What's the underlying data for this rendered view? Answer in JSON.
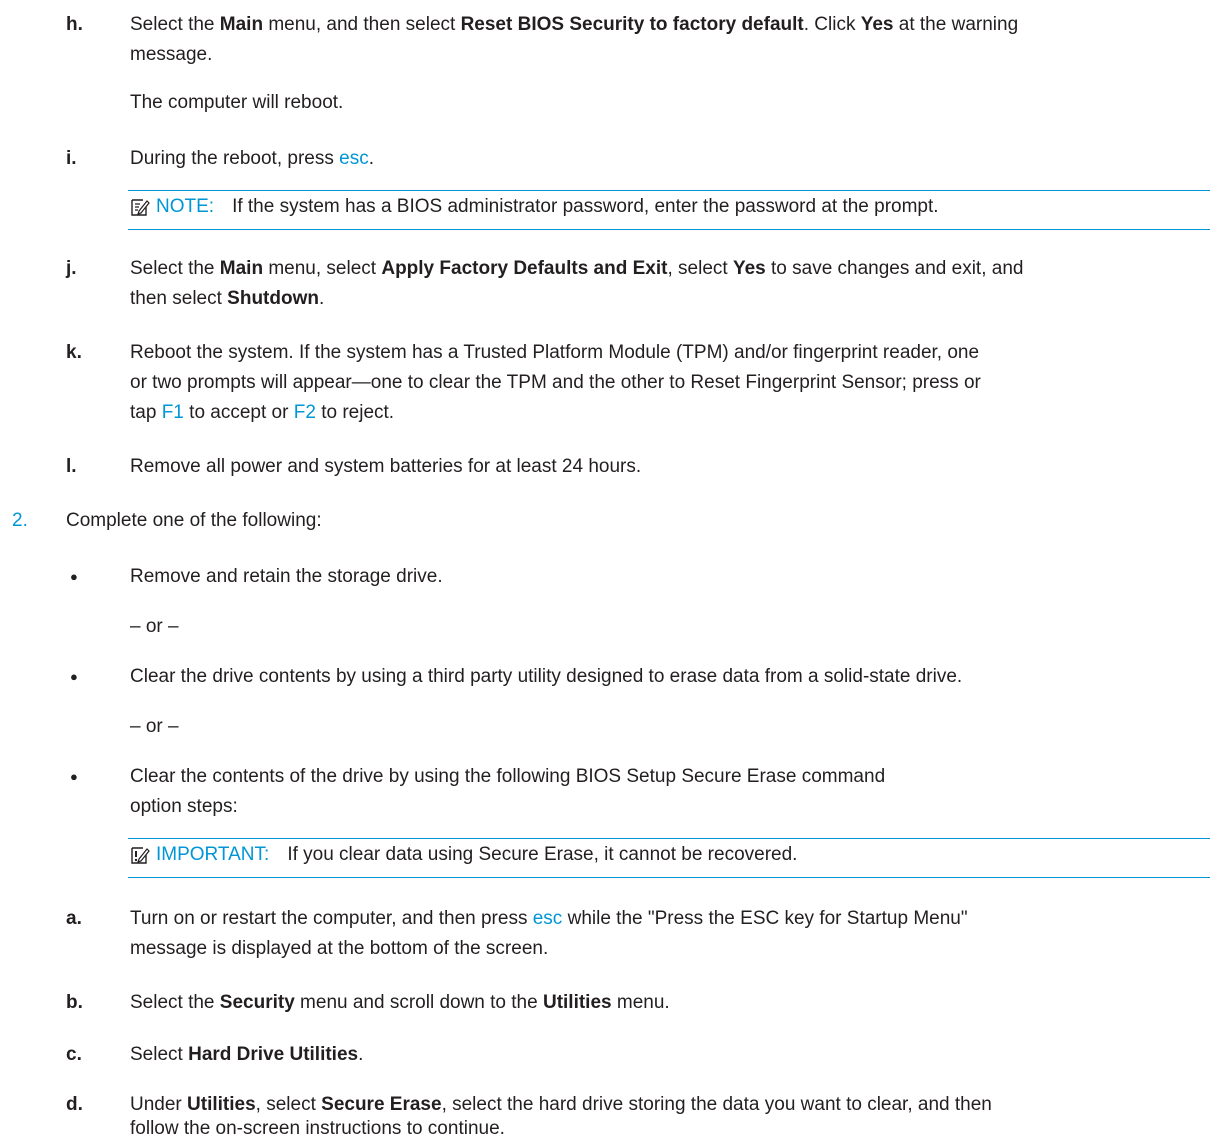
{
  "steps": {
    "h": {
      "marker": "h.",
      "p1": "Select the ",
      "main": "Main",
      "p2": " menu, and then select ",
      "reset": "Reset BIOS Security to factory default",
      "p3": ". Click ",
      "yes": "Yes",
      "p4": " at the warning",
      "line2": "message.",
      "reboot": "The computer will reboot."
    },
    "i": {
      "marker": "i.",
      "p1": "During the reboot, press ",
      "key": "esc",
      "p2": "."
    },
    "note": {
      "label": "NOTE:",
      "text": "If the system has a BIOS administrator password, enter the password at the prompt."
    },
    "j": {
      "marker": "j.",
      "p1": "Select the ",
      "main": "Main",
      "p2": " menu, select ",
      "apply": "Apply Factory Defaults and Exit",
      "p3": ", select ",
      "yes": "Yes",
      "p4": " to save changes and exit, and",
      "p5": "then select ",
      "shutdown": "Shutdown",
      "p6": "."
    },
    "k": {
      "marker": "k.",
      "line1": "Reboot the system. If the system has a Trusted Platform Module (TPM) and/or fingerprint reader, one",
      "line2": "or two prompts will appear—one to clear the TPM and the other to Reset Fingerprint Sensor; press or",
      "p1": "tap ",
      "f1": "F1",
      "p2": " to accept or ",
      "f2": "F2",
      "p3": " to reject."
    },
    "l": {
      "marker": "l.",
      "text": "Remove all power and system batteries for at least 24 hours."
    }
  },
  "step2": {
    "number": "2.",
    "text": "Complete one of the following:",
    "bullets": [
      "Remove and retain the storage drive.",
      "Clear the drive contents by using a third party utility designed to erase data from a solid-state drive.",
      "Clear the contents of the drive by using the following BIOS Setup Secure Erase command"
    ],
    "bullet3_line2": "option steps:",
    "or": "– or –",
    "bullet_char": "●"
  },
  "important": {
    "label": "IMPORTANT:",
    "text": "If you clear data using Secure Erase, it cannot be recovered."
  },
  "substeps": {
    "a": {
      "marker": "a.",
      "p1": "Turn on or restart the computer, and then press ",
      "key": "esc",
      "p2": " while the \"Press the ESC key for Startup Menu\"",
      "line2": "message is displayed at the bottom of the screen."
    },
    "b": {
      "marker": "b.",
      "p1": "Select the ",
      "security": "Security",
      "p2": " menu and scroll down to the ",
      "utilities": "Utilities",
      "p3": " menu."
    },
    "c": {
      "marker": "c.",
      "p1": "Select ",
      "hdu": "Hard Drive Utilities",
      "p2": "."
    },
    "d": {
      "marker": "d.",
      "p1": "Under ",
      "utilities": "Utilities",
      "p2": ", select ",
      "secure": "Secure Erase",
      "p3": ", select the hard drive storing the data you want to clear, and then",
      "line2": "follow the on-screen instructions to continue."
    }
  },
  "colors": {
    "accent": "#0096d6",
    "text": "#231f20"
  }
}
